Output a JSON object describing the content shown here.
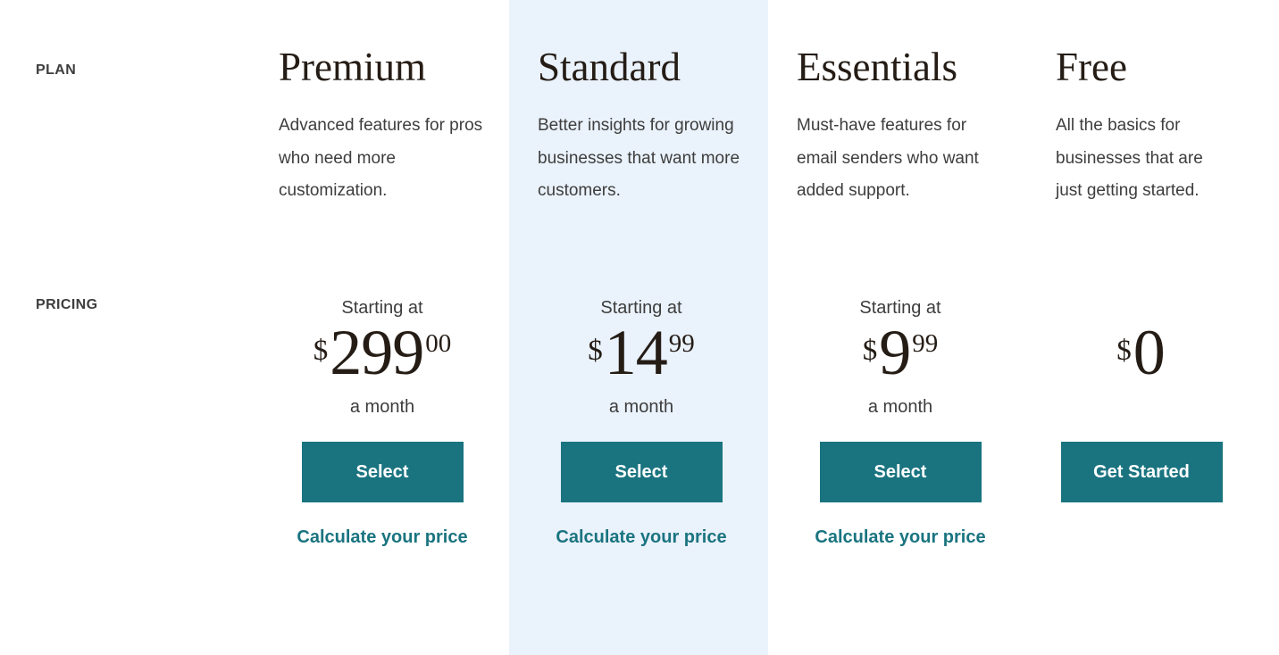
{
  "theme": {
    "accent": "#1a7480",
    "highlight_bg": "#eaf2fb",
    "text_dark": "#241c15",
    "text_body": "#3d3d3d"
  },
  "rows": {
    "plan_label": "PLAN",
    "pricing_label": "PRICING"
  },
  "plans": [
    {
      "name": "Premium",
      "description": "Advanced features for pros who need more customization.",
      "starting_at": "Starting at",
      "currency": "$",
      "amount": "299",
      "cents": "00",
      "period": "a month",
      "cta_label": "Select",
      "link_label": "Calculate your price",
      "highlighted": false
    },
    {
      "name": "Standard",
      "description": "Better insights for growing businesses that want more customers.",
      "starting_at": "Starting at",
      "currency": "$",
      "amount": "14",
      "cents": "99",
      "period": "a month",
      "cta_label": "Select",
      "link_label": "Calculate your price",
      "highlighted": true
    },
    {
      "name": "Essentials",
      "description": "Must-have features for email senders who want added support.",
      "starting_at": "Starting at",
      "currency": "$",
      "amount": "9",
      "cents": "99",
      "period": "a month",
      "cta_label": "Select",
      "link_label": "Calculate your price",
      "highlighted": false
    },
    {
      "name": "Free",
      "description": "All the basics for businesses that are just getting started.",
      "starting_at": "",
      "currency": "$",
      "amount": "0",
      "cents": "",
      "period": "",
      "cta_label": "Get Started",
      "link_label": "",
      "highlighted": false
    }
  ]
}
